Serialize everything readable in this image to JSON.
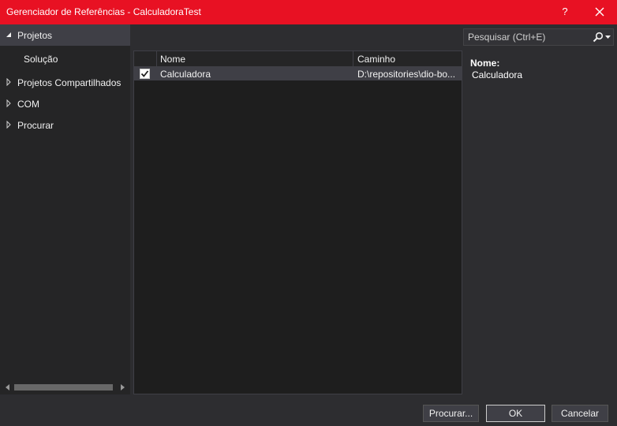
{
  "window": {
    "title": "Gerenciador de Referências - CalculadoraTest",
    "help_label": "?"
  },
  "sidebar": {
    "items": [
      {
        "label": "Projetos",
        "expanded": true
      },
      {
        "label": "Solução"
      },
      {
        "label": "Projetos Compartilhados",
        "expanded": false
      },
      {
        "label": "COM",
        "expanded": false
      },
      {
        "label": "Procurar",
        "expanded": false
      }
    ]
  },
  "search": {
    "placeholder": "Pesquisar (Ctrl+E)"
  },
  "grid": {
    "columns": [
      "Nome",
      "Caminho"
    ],
    "rows": [
      {
        "checked": true,
        "name": "Calculadora",
        "path": "D:\\repositories\\dio-bo..."
      }
    ]
  },
  "details": {
    "name_label": "Nome:",
    "name_value": "Calculadora"
  },
  "footer": {
    "browse_label": "Procurar...",
    "ok_label": "OK",
    "cancel_label": "Cancelar"
  },
  "colors": {
    "titlebar": "#e81123",
    "background": "#2d2d30",
    "panel": "#252526",
    "selection": "#3f3f46"
  }
}
